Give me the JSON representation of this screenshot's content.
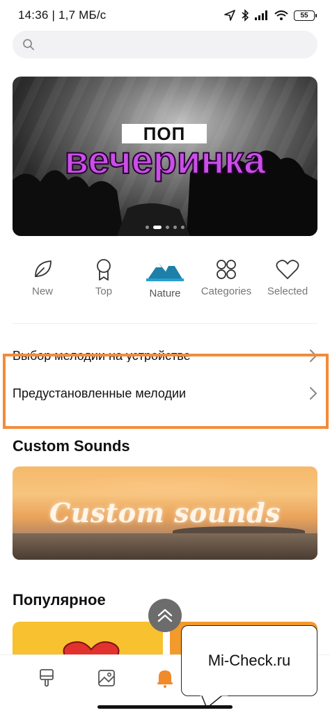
{
  "status_bar": {
    "time_speed": "14:36 | 1,7 МБ/с",
    "battery": "55"
  },
  "search": {
    "placeholder": ""
  },
  "banner": {
    "tag": "ПОП",
    "headline": "вечеринка",
    "slides": 5,
    "active_slide": 1
  },
  "categories": [
    {
      "label": "New",
      "icon": "leaf-icon"
    },
    {
      "label": "Top",
      "icon": "medal-icon"
    },
    {
      "label": "Nature",
      "icon": "mountains-icon"
    },
    {
      "label": "Categories",
      "icon": "grid-icon"
    },
    {
      "label": "Selected",
      "icon": "heart-icon"
    }
  ],
  "rows": {
    "device_melody": "Выбор мелодии на устройстве",
    "preset_melodies": "Предустановленные мелодии"
  },
  "sections": {
    "custom_title": "Custom Sounds",
    "custom_banner_text": "Custom sounds",
    "popular_title": "Популярное"
  },
  "tooltip": {
    "text": "Mi-Check.ru"
  },
  "colors": {
    "accent": "#f38b39",
    "nav_active": "#f08a2a",
    "headline": "#c94fe7"
  }
}
